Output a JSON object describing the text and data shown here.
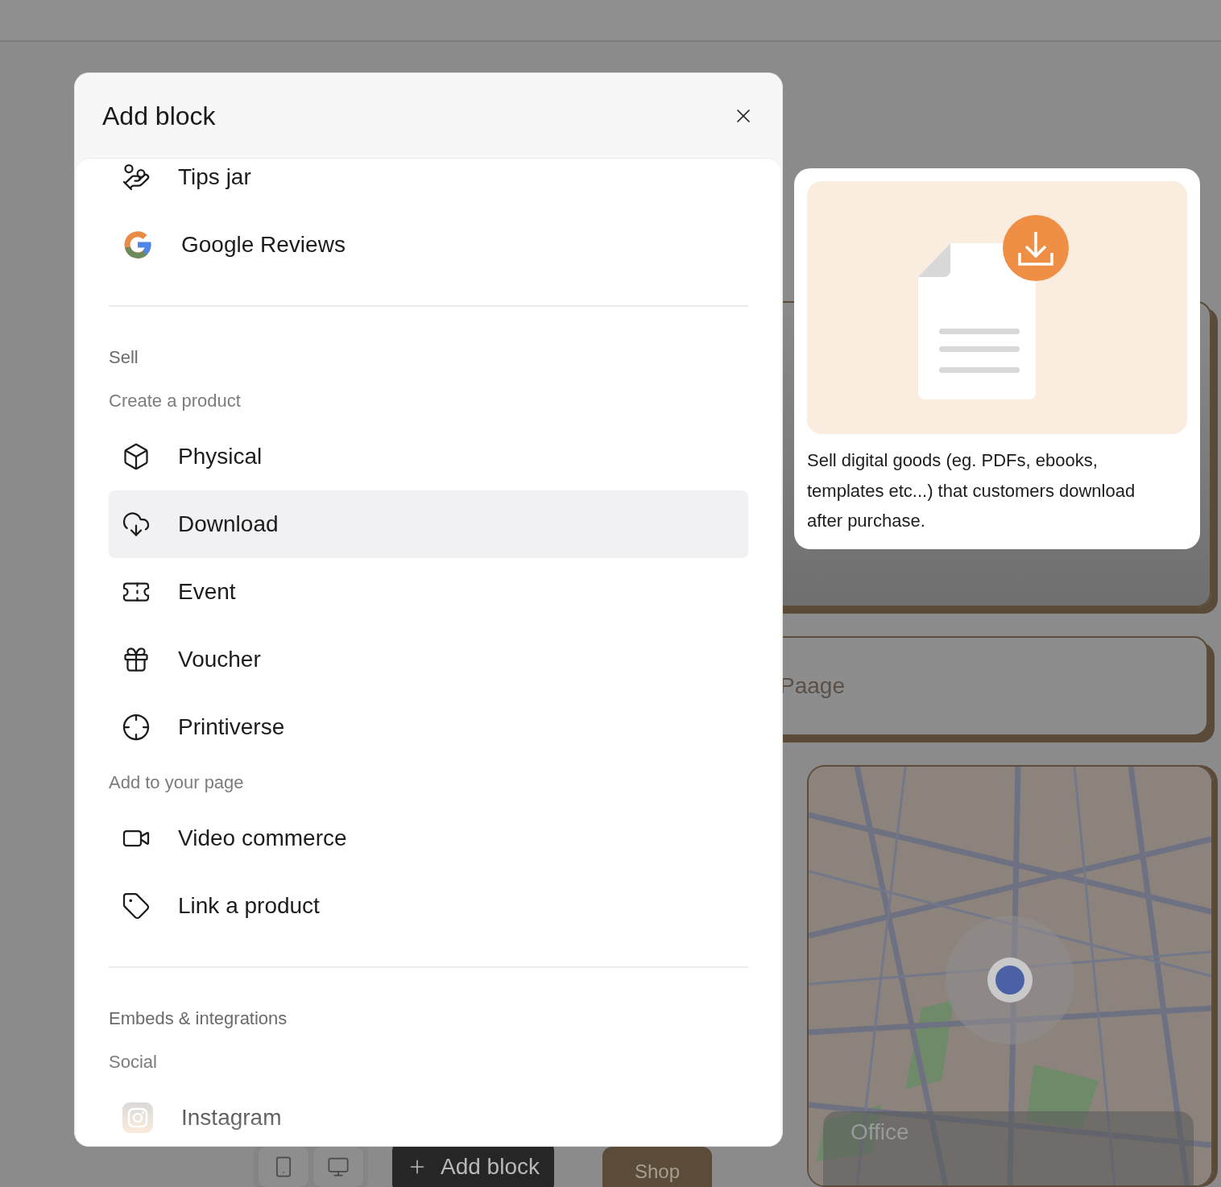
{
  "modal": {
    "title": "Add block",
    "entries": [
      {
        "kind": "item",
        "label": "Tips jar",
        "selected": false
      },
      {
        "kind": "item",
        "label": "Google Reviews",
        "selected": false
      },
      {
        "kind": "divider"
      },
      {
        "kind": "heading",
        "label": "Sell"
      },
      {
        "kind": "subheading",
        "label": "Create a product"
      },
      {
        "kind": "item",
        "label": "Physical",
        "selected": false
      },
      {
        "kind": "item",
        "label": "Download",
        "selected": true
      },
      {
        "kind": "item",
        "label": "Event",
        "selected": false
      },
      {
        "kind": "item",
        "label": "Voucher",
        "selected": false
      },
      {
        "kind": "item",
        "label": "Printiverse",
        "selected": false
      },
      {
        "kind": "subheading",
        "label": "Add to your page"
      },
      {
        "kind": "item",
        "label": "Video commerce",
        "selected": false
      },
      {
        "kind": "item",
        "label": "Link a product",
        "selected": false
      },
      {
        "kind": "divider"
      },
      {
        "kind": "heading",
        "label": "Embeds & integrations"
      },
      {
        "kind": "subheading",
        "label": "Social"
      },
      {
        "kind": "item",
        "label": "Instagram",
        "selected": false
      }
    ]
  },
  "preview": {
    "description": "Sell digital goods (eg. PDFs, ebooks, templates etc...) that customers download after purchase."
  },
  "background": {
    "card_text": "Paage",
    "map": {
      "kind": "picture",
      "overlay_title": "Office"
    },
    "toolbar": {
      "add_button": "Add block",
      "shop_button": "Shop"
    }
  }
}
